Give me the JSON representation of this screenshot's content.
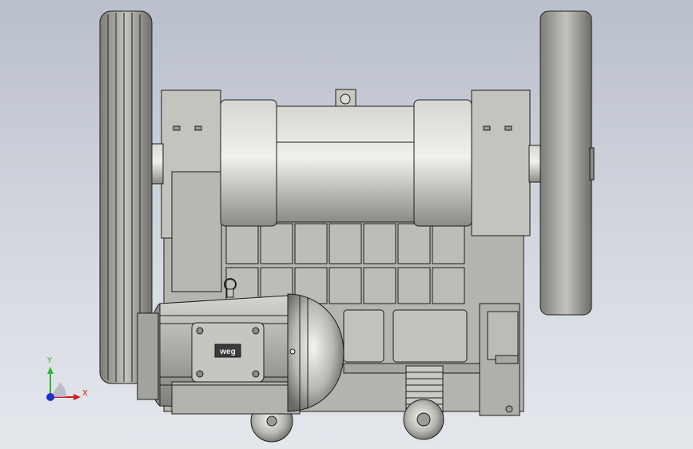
{
  "viewport": {
    "background_top": "#b9bfcb",
    "background_bottom": "#e4e7ec"
  },
  "model": {
    "body_color": "#b7b7b2",
    "shade_color": "#8f8f8a",
    "highlight_color": "#e6e6e1",
    "edge_color": "#1c1c1c",
    "motor_nameplate": "weg"
  },
  "triad": {
    "y_label": "Y",
    "x_label": "X",
    "y_color": "#2fb52f",
    "x_color": "#d02020",
    "z_color": "#2030d0"
  }
}
